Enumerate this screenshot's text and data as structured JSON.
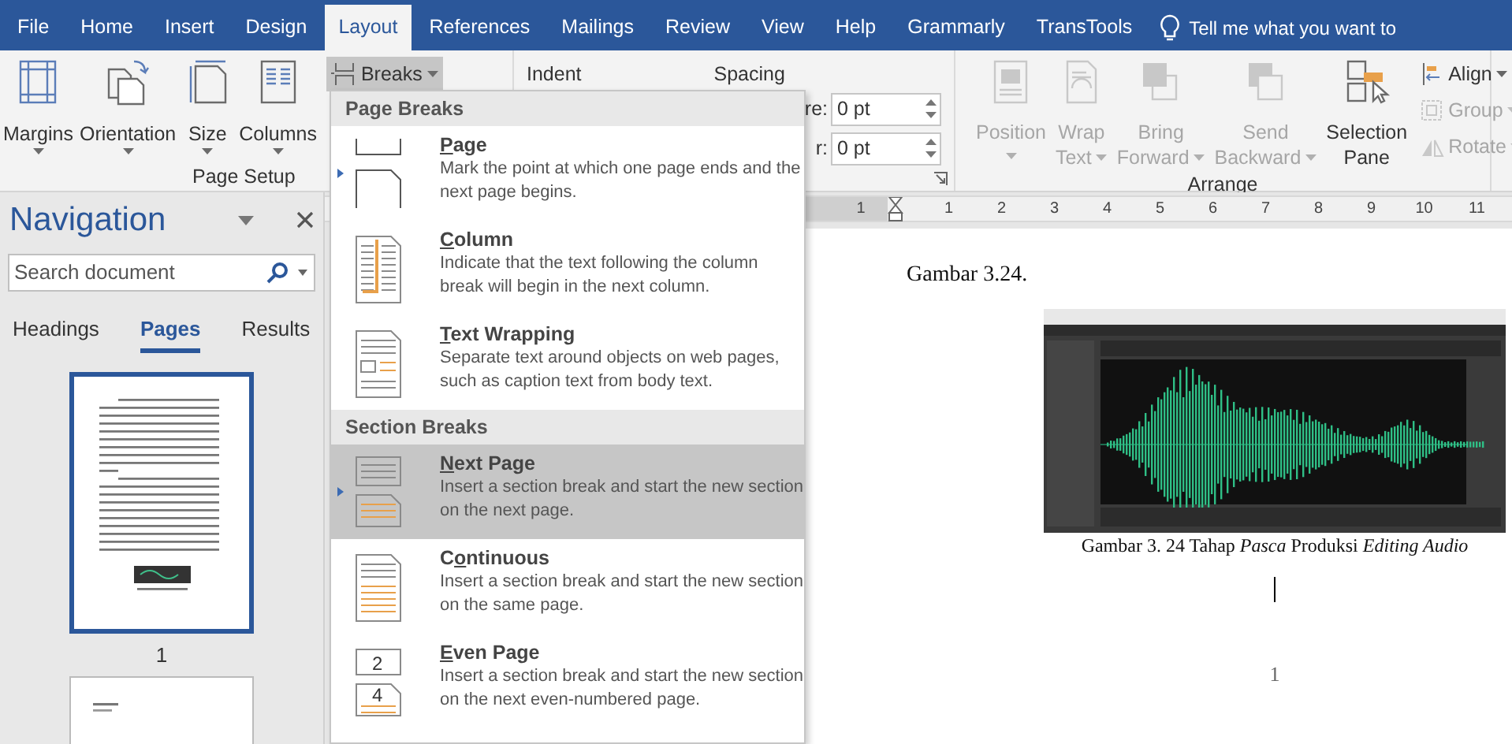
{
  "tabs": [
    {
      "label": "File",
      "selected": false
    },
    {
      "label": "Home",
      "selected": false
    },
    {
      "label": "Insert",
      "selected": false
    },
    {
      "label": "Design",
      "selected": false
    },
    {
      "label": "Layout",
      "selected": true
    },
    {
      "label": "References",
      "selected": false
    },
    {
      "label": "Mailings",
      "selected": false
    },
    {
      "label": "Review",
      "selected": false
    },
    {
      "label": "View",
      "selected": false
    },
    {
      "label": "Help",
      "selected": false
    },
    {
      "label": "Grammarly",
      "selected": false
    },
    {
      "label": "TransTools",
      "selected": false
    }
  ],
  "tell_me": "Tell me what you want to",
  "ribbon": {
    "page_setup": {
      "buttons": [
        {
          "label": "Margins",
          "kind": "margins"
        },
        {
          "label": "Orientation",
          "kind": "orientation"
        },
        {
          "label": "Size",
          "kind": "size"
        },
        {
          "label": "Columns",
          "kind": "columns"
        }
      ],
      "breaks": {
        "label": "Breaks",
        "pressed": true
      },
      "group_label": "Page Setup"
    },
    "paragraph": {
      "indent_label": "Indent",
      "spacing_label": "Spacing",
      "fields": [
        {
          "label": "re:",
          "value": "0 pt"
        },
        {
          "label": "r:",
          "value": "0 pt"
        }
      ]
    },
    "arrange": {
      "buttons": [
        {
          "lines": [
            "Position"
          ],
          "kind": "position",
          "disabled": true,
          "dropdown": true
        },
        {
          "lines": [
            "Wrap",
            "Text"
          ],
          "kind": "wrap",
          "disabled": true,
          "dropdown": true
        },
        {
          "lines": [
            "Bring",
            "Forward"
          ],
          "kind": "forward",
          "disabled": true,
          "dropdown": true
        },
        {
          "lines": [
            "Send",
            "Backward"
          ],
          "kind": "backward",
          "disabled": true,
          "dropdown": true
        },
        {
          "lines": [
            "Selection",
            "Pane"
          ],
          "kind": "selection",
          "disabled": false,
          "dropdown": false
        }
      ],
      "small": [
        {
          "label": "Align",
          "kind": "align",
          "disabled": false
        },
        {
          "label": "Group",
          "kind": "group",
          "disabled": true
        },
        {
          "label": "Rotate",
          "kind": "rotate",
          "disabled": true
        }
      ],
      "group_label": "Arrange"
    }
  },
  "navigation": {
    "title": "Navigation",
    "search": {
      "placeholder": "Search document"
    },
    "tabs": [
      {
        "label": "Headings",
        "selected": false
      },
      {
        "label": "Pages",
        "selected": true
      },
      {
        "label": "Results",
        "selected": false
      }
    ],
    "pages": [
      {
        "label": "1",
        "selected": true
      },
      {
        "selected": false
      }
    ]
  },
  "ruler": {
    "labels": [
      "1",
      "1",
      "2",
      "3",
      "4",
      "5",
      "6",
      "7",
      "8",
      "9",
      "10",
      "11"
    ]
  },
  "document": {
    "heading": "Gambar 3.24.",
    "caption": "Gambar 3. 24 Tahap *Pasca* Produksi *Editing Audio*",
    "page_number": "1"
  },
  "breaks_menu": {
    "sections": [
      {
        "title": "Page Breaks",
        "items": [
          {
            "kind": "page",
            "access_key": "P",
            "title_rest": "age",
            "description": "Mark the point at which one page ends and the next page begins.",
            "selected": false
          },
          {
            "kind": "column",
            "access_key": "C",
            "title_rest": "olumn",
            "description": "Indicate that the text following the column break will begin in the next column.",
            "selected": false
          },
          {
            "kind": "wrapping",
            "access_key": "T",
            "title_rest": "ext Wrapping",
            "description": "Separate text around objects on web pages, such as caption text from body text.",
            "selected": false
          }
        ]
      },
      {
        "title": "Section Breaks",
        "items": [
          {
            "kind": "next",
            "access_key": "N",
            "title_rest": "ext Page",
            "description": "Insert a section break and start the new section on the next page.",
            "selected": true
          },
          {
            "kind": "continuous",
            "title_lead": "C",
            "access_key": "o",
            "title_rest": "ntinuous",
            "description": "Insert a section break and start the new section on the same page.",
            "selected": false
          },
          {
            "kind": "even",
            "access_key": "E",
            "title_rest": "ven Page",
            "description": "Insert a section break and start the new section on the next even-numbered page.",
            "selected": false,
            "icon_labels": [
              "2",
              "4"
            ]
          }
        ]
      }
    ]
  }
}
